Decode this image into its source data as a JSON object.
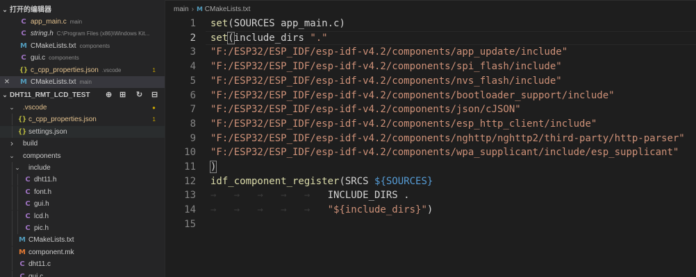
{
  "open_editors": {
    "header": "打开的编辑器",
    "items": [
      {
        "icon": "c",
        "name": "app_main.c",
        "desc": "main",
        "modified": true
      },
      {
        "icon": "c",
        "name": "string.h",
        "desc": "C:\\Program Files (x86)\\Windows Kit...",
        "italic": true
      },
      {
        "icon": "m",
        "name": "CMakeLists.txt",
        "desc": "components"
      },
      {
        "icon": "c",
        "name": "gui.c",
        "desc": "components"
      },
      {
        "icon": "json",
        "name": "c_cpp_properties.json",
        "desc": ".vscode",
        "count": "1",
        "warning": true
      },
      {
        "icon": "m",
        "name": "CMakeLists.txt",
        "desc": "main",
        "active": true,
        "close": "✕"
      }
    ]
  },
  "explorer": {
    "header": "DHT11_RMT_LCD_TEST",
    "tree": [
      {
        "label": ".vscode",
        "type": "folder",
        "open": true,
        "depth": 0,
        "warning": true,
        "count": "●"
      },
      {
        "label": "c_cpp_properties.json",
        "type": "json",
        "depth": 1,
        "warning": true,
        "count": "1"
      },
      {
        "label": "settings.json",
        "type": "json",
        "depth": 1,
        "selected": true
      },
      {
        "label": "build",
        "type": "folder",
        "open": false,
        "depth": 0
      },
      {
        "label": "components",
        "type": "folder",
        "open": true,
        "depth": 0
      },
      {
        "label": "include",
        "type": "folder",
        "open": true,
        "depth": 1
      },
      {
        "label": "dht11.h",
        "type": "c",
        "depth": 2
      },
      {
        "label": "font.h",
        "type": "c",
        "depth": 2
      },
      {
        "label": "gui.h",
        "type": "c",
        "depth": 2
      },
      {
        "label": "lcd.h",
        "type": "c",
        "depth": 2
      },
      {
        "label": "pic.h",
        "type": "c",
        "depth": 2
      },
      {
        "label": "CMakeLists.txt",
        "type": "m",
        "depth": 1
      },
      {
        "label": "component.mk",
        "type": "mk",
        "depth": 1
      },
      {
        "label": "dht11.c",
        "type": "c",
        "depth": 1
      },
      {
        "label": "gui.c",
        "type": "c",
        "depth": 1
      }
    ]
  },
  "breadcrumb": {
    "folder": "main",
    "file": "CMakeLists.txt"
  },
  "editor": {
    "current_line": 2,
    "lines": [
      {
        "n": "1",
        "tokens": [
          {
            "t": "set",
            "c": "fn"
          },
          {
            "t": "(SOURCES app_main.c)",
            "c": "plain"
          }
        ]
      },
      {
        "n": "2",
        "tokens": [
          {
            "t": "set",
            "c": "fn"
          },
          {
            "t": "(",
            "c": "plain",
            "match": true
          },
          {
            "t": "include_dirs ",
            "c": "plain"
          },
          {
            "t": "\".\"",
            "c": "str"
          }
        ]
      },
      {
        "n": "3",
        "tokens": [
          {
            "t": "\"F:/ESP32/ESP_IDF/esp-idf-v4.2/components/app_update/include\"",
            "c": "str"
          }
        ]
      },
      {
        "n": "4",
        "tokens": [
          {
            "t": "\"F:/ESP32/ESP_IDF/esp-idf-v4.2/components/spi_flash/include\"",
            "c": "str"
          }
        ]
      },
      {
        "n": "5",
        "tokens": [
          {
            "t": "\"F:/ESP32/ESP_IDF/esp-idf-v4.2/components/nvs_flash/include\"",
            "c": "str"
          }
        ]
      },
      {
        "n": "6",
        "tokens": [
          {
            "t": "\"F:/ESP32/ESP_IDF/esp-idf-v4.2/components/bootloader_support/include\"",
            "c": "str"
          }
        ]
      },
      {
        "n": "7",
        "tokens": [
          {
            "t": "\"F:/ESP32/ESP_IDF/esp-idf-v4.2/components/json/cJSON\"",
            "c": "str"
          }
        ]
      },
      {
        "n": "8",
        "tokens": [
          {
            "t": "\"F:/ESP32/ESP_IDF/esp-idf-v4.2/components/esp_http_client/include\"",
            "c": "str"
          }
        ]
      },
      {
        "n": "9",
        "tokens": [
          {
            "t": "\"F:/ESP32/ESP_IDF/esp-idf-v4.2/components/nghttp/nghttp2/third-party/http-parser\"",
            "c": "str"
          }
        ]
      },
      {
        "n": "10",
        "tokens": [
          {
            "t": "\"F:/ESP32/ESP_IDF/esp-idf-v4.2/components/wpa_supplicant/include/esp_supplicant\"",
            "c": "str"
          }
        ]
      },
      {
        "n": "11",
        "tokens": [
          {
            "t": ")",
            "c": "plain",
            "match": true
          }
        ]
      },
      {
        "n": "12",
        "tokens": [
          {
            "t": "idf_component_register",
            "c": "fn"
          },
          {
            "t": "(SRCS ",
            "c": "plain"
          },
          {
            "t": "${SOURCES}",
            "c": "var"
          }
        ]
      },
      {
        "n": "13",
        "tokens": [
          {
            "t": "→   →   →   →   →   ",
            "c": "ws"
          },
          {
            "t": "INCLUDE_DIRS .",
            "c": "plain"
          }
        ]
      },
      {
        "n": "14",
        "tokens": [
          {
            "t": "→   →   →   →   →   ",
            "c": "ws"
          },
          {
            "t": "\"${include_dirs}\"",
            "c": "str"
          },
          {
            "t": ")",
            "c": "plain"
          }
        ]
      },
      {
        "n": "15",
        "tokens": []
      }
    ]
  },
  "colors": {
    "fn": "#dcdcaa",
    "str": "#ce9178",
    "plain": "#d4d4d4",
    "var": "#569cd6",
    "warning": "#cca700"
  }
}
